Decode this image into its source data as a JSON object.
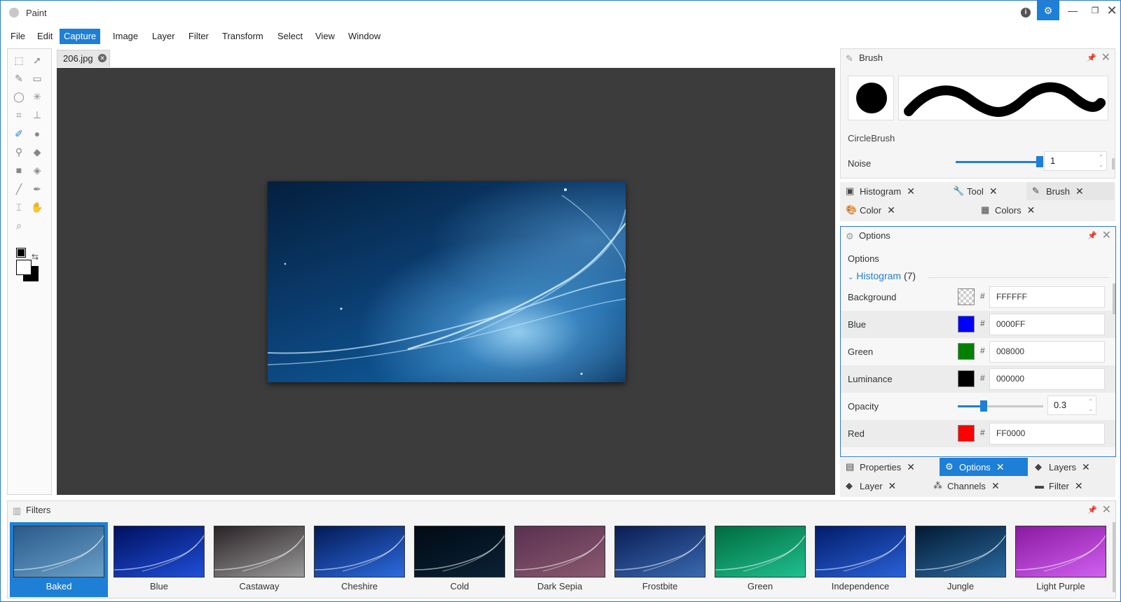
{
  "app": {
    "title": "Paint"
  },
  "titlebar": {
    "info": "i",
    "gear": "⚙",
    "minimize": "—",
    "maximize": "❐",
    "close": "✕"
  },
  "menu": [
    "File",
    "Edit",
    "Capture",
    "Image",
    "Layer",
    "Filter",
    "Transform",
    "Select",
    "View",
    "Window"
  ],
  "menu_active": "Capture",
  "document": {
    "tab_name": "206.jpg"
  },
  "brush_panel": {
    "title": "Brush",
    "brush_name": "CircleBrush",
    "noise_label": "Noise",
    "noise_value": "1",
    "noise_fraction": 1.0
  },
  "upper_tabs": [
    {
      "label": "Histogram",
      "icon": "histogram-icon"
    },
    {
      "label": "Tool",
      "icon": "wrench-icon"
    },
    {
      "label": "Brush",
      "icon": "brush-icon"
    },
    {
      "label": "Color",
      "icon": "palette-icon"
    },
    {
      "label": "Colors",
      "icon": "grid-icon"
    }
  ],
  "options_panel": {
    "title": "Options",
    "heading": "Options",
    "group": "Histogram",
    "group_count": "(7)",
    "rows": [
      {
        "label": "Background",
        "hex": "FFFFFF",
        "swatch": "transparent"
      },
      {
        "label": "Blue",
        "hex": "0000FF",
        "swatch": "#0000FF"
      },
      {
        "label": "Green",
        "hex": "008000",
        "swatch": "#008000"
      },
      {
        "label": "Luminance",
        "hex": "000000",
        "swatch": "#000000"
      },
      {
        "label": "Opacity",
        "value": "0.3",
        "fraction": 0.3
      },
      {
        "label": "Red",
        "hex": "FF0000",
        "swatch": "#FF0000"
      }
    ]
  },
  "lower_tabs": [
    {
      "label": "Properties",
      "icon": "properties-icon"
    },
    {
      "label": "Options",
      "icon": "gear-icon",
      "active": true
    },
    {
      "label": "Layers",
      "icon": "layers-icon"
    },
    {
      "label": "Layer",
      "icon": "layer-icon"
    },
    {
      "label": "Channels",
      "icon": "channels-icon"
    },
    {
      "label": "Filter",
      "icon": "filter-icon"
    }
  ],
  "filters_panel": {
    "title": "Filters",
    "items": [
      {
        "label": "Baked",
        "selected": true,
        "tint": "linear-gradient(160deg,#2a5a8a,#6aa0c8)"
      },
      {
        "label": "Blue",
        "tint": "linear-gradient(160deg,#001060,#1f4fd8)"
      },
      {
        "label": "Castaway",
        "tint": "linear-gradient(160deg,#2a2226,#9a9a9a)"
      },
      {
        "label": "Cheshire",
        "tint": "linear-gradient(160deg,#031a55,#2d6be0)"
      },
      {
        "label": "Cold",
        "tint": "linear-gradient(160deg,#010a14,#0b2236)"
      },
      {
        "label": "Dark Sepia",
        "tint": "linear-gradient(160deg,#5a3050,#8a5a70)"
      },
      {
        "label": "Frostbite",
        "tint": "linear-gradient(160deg,#0a1d55,#3a6ab0)"
      },
      {
        "label": "Green",
        "tint": "linear-gradient(160deg,#006b3e,#20c090)"
      },
      {
        "label": "Independence",
        "tint": "linear-gradient(160deg,#021c6a,#2a62d8)"
      },
      {
        "label": "Jungle",
        "tint": "linear-gradient(160deg,#031a33,#2a6aa0)"
      },
      {
        "label": "Light Purple",
        "tint": "linear-gradient(160deg,#8a1aa0,#d060f0)"
      }
    ]
  }
}
